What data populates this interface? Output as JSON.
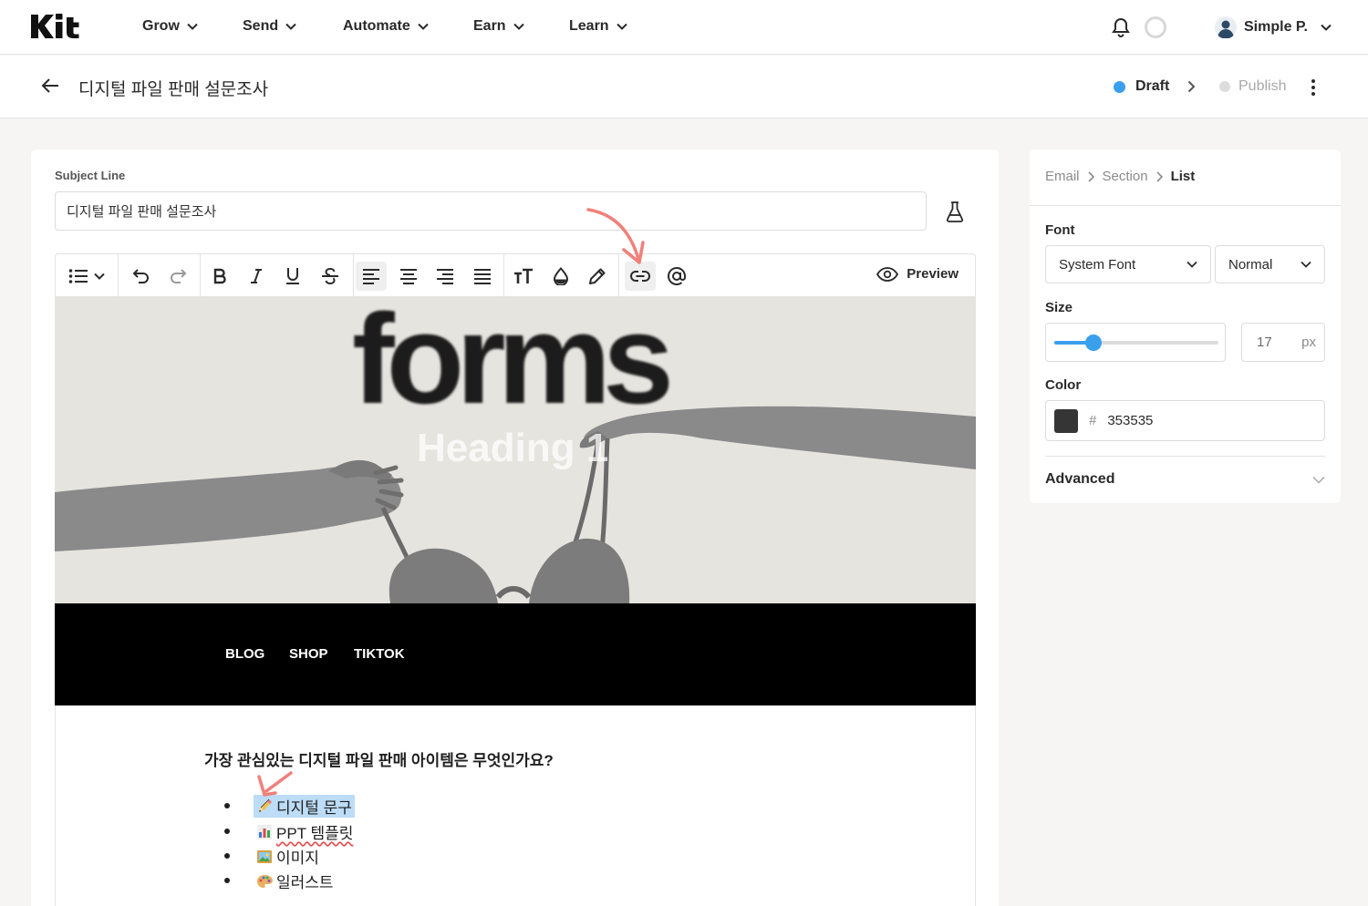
{
  "app": {
    "logo": "Kit"
  },
  "nav": {
    "items": [
      {
        "label": "Grow"
      },
      {
        "label": "Send"
      },
      {
        "label": "Automate"
      },
      {
        "label": "Earn"
      },
      {
        "label": "Learn"
      }
    ]
  },
  "user": {
    "name": "Simple P."
  },
  "titlebar": {
    "title": "디지털 파일 판매 설문조사",
    "draft": "Draft",
    "publish": "Publish"
  },
  "editor": {
    "subject_label": "Subject Line",
    "subject_value": "디지털 파일 판매 설문조사",
    "preview_label": "Preview"
  },
  "hero": {
    "logo_text": "forms",
    "overlay_text": "Heading 1"
  },
  "email_nav": {
    "links": [
      "BLOG",
      "SHOP",
      "TIKTOK"
    ]
  },
  "content": {
    "question": "가장 관심있는 디지털 파일 판매 아이템은 무엇인가요?",
    "list": [
      {
        "icon": "pencil-emoji",
        "text": "디지털 문구"
      },
      {
        "icon": "bar-chart-emoji",
        "text": "PPT 템플릿"
      },
      {
        "icon": "picture-emoji",
        "text": "이미지"
      },
      {
        "icon": "palette-emoji",
        "text": "일러스트"
      }
    ]
  },
  "panel": {
    "breadcrumbs": [
      "Email",
      "Section",
      "List"
    ],
    "font_label": "Font",
    "font_family": "System Font",
    "font_weight": "Normal",
    "size_label": "Size",
    "size_value": "17",
    "size_unit": "px",
    "size_slider_fraction": 0.24,
    "color_label": "Color",
    "color_hash": "#",
    "color_value": "353535",
    "advanced_label": "Advanced"
  },
  "colors": {
    "accent": "#3aa0ee",
    "text_color": "#353535",
    "annotation": "#f0807a",
    "selection": "#bcdcf7",
    "publish_dot": "#dcdcdc"
  }
}
